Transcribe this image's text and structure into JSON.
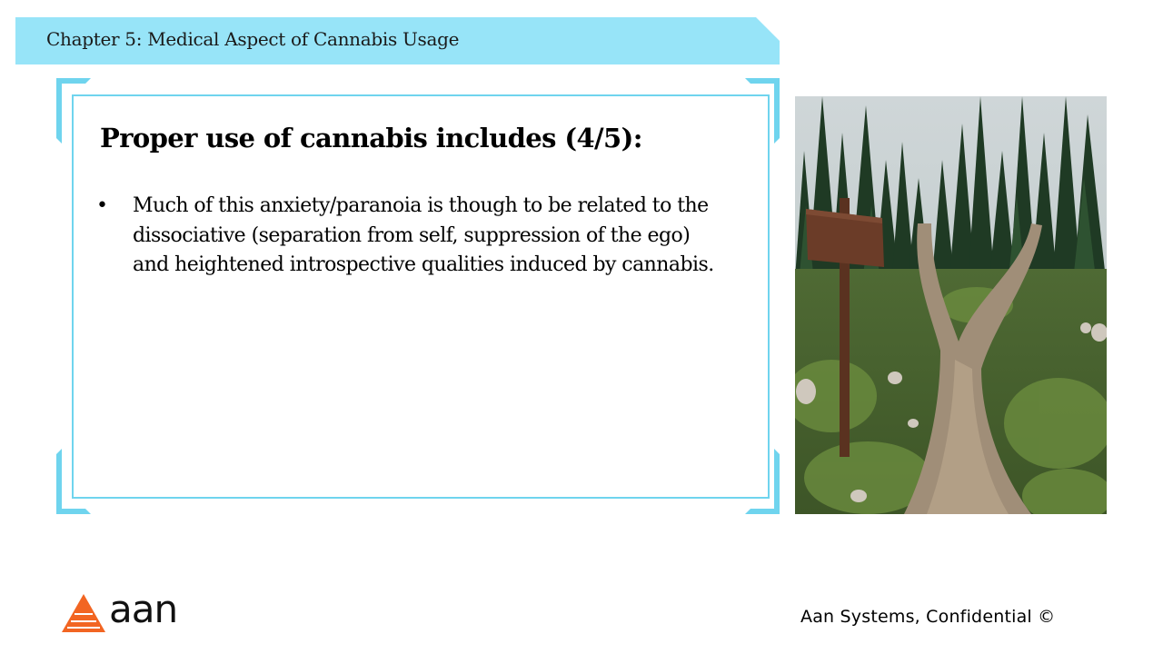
{
  "header": {
    "title": "Chapter 5: Medical Aspect of Cannabis Usage"
  },
  "slide": {
    "heading": "Proper use of cannabis includes (4/5):",
    "bullets": [
      {
        "marker": "•",
        "text": "Much of this anxiety/paranoia is though to be related to the dissociative (separation from self, suppression of the ego) and heightened introspective qualities induced by cannabis."
      }
    ]
  },
  "image": {
    "subject": "forest trail fork with blank wooden signpost"
  },
  "footer": {
    "logo_text": "aan",
    "confidential": "Aan Systems, Confidential ©"
  },
  "colors": {
    "banner": "#97e4f8",
    "frame": "#6fd4ee",
    "logo_orange": "#f26522"
  }
}
